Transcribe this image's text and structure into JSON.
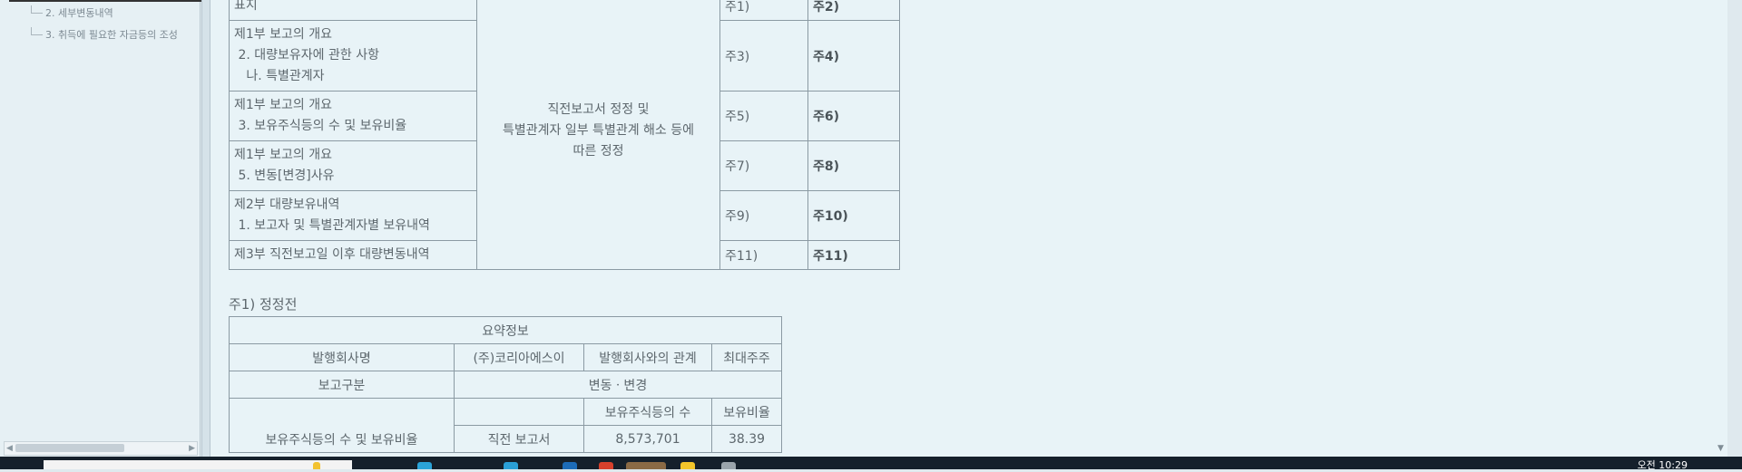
{
  "sidebar": {
    "items": [
      {
        "label": "2. 세부변동내역"
      },
      {
        "label": "3. 취득에 필요한 자금등의 조성"
      }
    ]
  },
  "correction_table": {
    "rows": [
      {
        "item": "표지",
        "before": "주1)",
        "after": "주2)"
      },
      {
        "item": "제1부 보고의 개요\n 2. 대량보유자에 관한 사항\n   나. 특별관계자",
        "before": "주3)",
        "after": "주4)"
      },
      {
        "item": "제1부 보고의 개요\n 3. 보유주식등의 수 및 보유비율",
        "before": "주5)",
        "after": "주6)"
      },
      {
        "item": "제1부 보고의 개요\n 5. 변동[변경]사유",
        "before": "주7)",
        "after": "주8)"
      },
      {
        "item": "제2부 대량보유내역\n 1. 보고자 및 특별관계자별 보유내역",
        "before": "주9)",
        "after": "주10)"
      },
      {
        "item": "제3부 직전보고일 이후 대량변동내역",
        "before": "주11)",
        "after": "주11)"
      }
    ],
    "reason": "직전보고서 정정 및\n특별관계자 일부 특별관계 해소 등에\n따른 정정"
  },
  "note1": {
    "title": "주1) 정정전",
    "summary_header": "요약정보",
    "issuer_label": "발행회사명",
    "issuer_value": "(주)코리아에스이",
    "relation_label": "발행회사와의 관계",
    "relation_value": "최대주주",
    "report_type_label": "보고구분",
    "report_type_value": "변동ㆍ변경",
    "holdings_label": "보유주식등의 수 및 보유비율",
    "col_shares": "보유주식등의 수",
    "col_ratio": "보유비율",
    "prev_report_label": "직전 보고서",
    "prev_shares": "8,573,701",
    "prev_ratio": "38.39"
  },
  "taskbar": {
    "clock": "오전 10:29"
  }
}
